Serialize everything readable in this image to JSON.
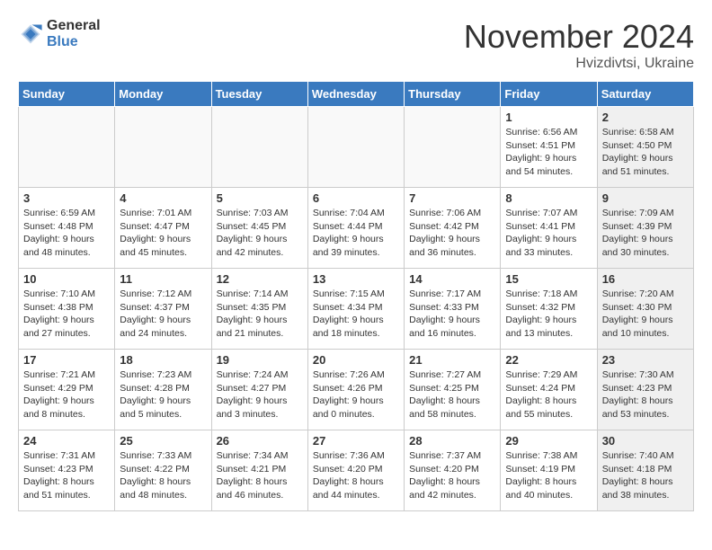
{
  "header": {
    "logo_general": "General",
    "logo_blue": "Blue",
    "month_title": "November 2024",
    "location": "Hvizdivtsi, Ukraine"
  },
  "weekdays": [
    "Sunday",
    "Monday",
    "Tuesday",
    "Wednesday",
    "Thursday",
    "Friday",
    "Saturday"
  ],
  "weeks": [
    [
      {
        "day": "",
        "info": "",
        "shaded": false,
        "empty": true
      },
      {
        "day": "",
        "info": "",
        "shaded": false,
        "empty": true
      },
      {
        "day": "",
        "info": "",
        "shaded": false,
        "empty": true
      },
      {
        "day": "",
        "info": "",
        "shaded": false,
        "empty": true
      },
      {
        "day": "",
        "info": "",
        "shaded": false,
        "empty": true
      },
      {
        "day": "1",
        "info": "Sunrise: 6:56 AM\nSunset: 4:51 PM\nDaylight: 9 hours\nand 54 minutes.",
        "shaded": false,
        "empty": false
      },
      {
        "day": "2",
        "info": "Sunrise: 6:58 AM\nSunset: 4:50 PM\nDaylight: 9 hours\nand 51 minutes.",
        "shaded": true,
        "empty": false
      }
    ],
    [
      {
        "day": "3",
        "info": "Sunrise: 6:59 AM\nSunset: 4:48 PM\nDaylight: 9 hours\nand 48 minutes.",
        "shaded": false,
        "empty": false
      },
      {
        "day": "4",
        "info": "Sunrise: 7:01 AM\nSunset: 4:47 PM\nDaylight: 9 hours\nand 45 minutes.",
        "shaded": false,
        "empty": false
      },
      {
        "day": "5",
        "info": "Sunrise: 7:03 AM\nSunset: 4:45 PM\nDaylight: 9 hours\nand 42 minutes.",
        "shaded": false,
        "empty": false
      },
      {
        "day": "6",
        "info": "Sunrise: 7:04 AM\nSunset: 4:44 PM\nDaylight: 9 hours\nand 39 minutes.",
        "shaded": false,
        "empty": false
      },
      {
        "day": "7",
        "info": "Sunrise: 7:06 AM\nSunset: 4:42 PM\nDaylight: 9 hours\nand 36 minutes.",
        "shaded": false,
        "empty": false
      },
      {
        "day": "8",
        "info": "Sunrise: 7:07 AM\nSunset: 4:41 PM\nDaylight: 9 hours\nand 33 minutes.",
        "shaded": false,
        "empty": false
      },
      {
        "day": "9",
        "info": "Sunrise: 7:09 AM\nSunset: 4:39 PM\nDaylight: 9 hours\nand 30 minutes.",
        "shaded": true,
        "empty": false
      }
    ],
    [
      {
        "day": "10",
        "info": "Sunrise: 7:10 AM\nSunset: 4:38 PM\nDaylight: 9 hours\nand 27 minutes.",
        "shaded": false,
        "empty": false
      },
      {
        "day": "11",
        "info": "Sunrise: 7:12 AM\nSunset: 4:37 PM\nDaylight: 9 hours\nand 24 minutes.",
        "shaded": false,
        "empty": false
      },
      {
        "day": "12",
        "info": "Sunrise: 7:14 AM\nSunset: 4:35 PM\nDaylight: 9 hours\nand 21 minutes.",
        "shaded": false,
        "empty": false
      },
      {
        "day": "13",
        "info": "Sunrise: 7:15 AM\nSunset: 4:34 PM\nDaylight: 9 hours\nand 18 minutes.",
        "shaded": false,
        "empty": false
      },
      {
        "day": "14",
        "info": "Sunrise: 7:17 AM\nSunset: 4:33 PM\nDaylight: 9 hours\nand 16 minutes.",
        "shaded": false,
        "empty": false
      },
      {
        "day": "15",
        "info": "Sunrise: 7:18 AM\nSunset: 4:32 PM\nDaylight: 9 hours\nand 13 minutes.",
        "shaded": false,
        "empty": false
      },
      {
        "day": "16",
        "info": "Sunrise: 7:20 AM\nSunset: 4:30 PM\nDaylight: 9 hours\nand 10 minutes.",
        "shaded": true,
        "empty": false
      }
    ],
    [
      {
        "day": "17",
        "info": "Sunrise: 7:21 AM\nSunset: 4:29 PM\nDaylight: 9 hours\nand 8 minutes.",
        "shaded": false,
        "empty": false
      },
      {
        "day": "18",
        "info": "Sunrise: 7:23 AM\nSunset: 4:28 PM\nDaylight: 9 hours\nand 5 minutes.",
        "shaded": false,
        "empty": false
      },
      {
        "day": "19",
        "info": "Sunrise: 7:24 AM\nSunset: 4:27 PM\nDaylight: 9 hours\nand 3 minutes.",
        "shaded": false,
        "empty": false
      },
      {
        "day": "20",
        "info": "Sunrise: 7:26 AM\nSunset: 4:26 PM\nDaylight: 9 hours\nand 0 minutes.",
        "shaded": false,
        "empty": false
      },
      {
        "day": "21",
        "info": "Sunrise: 7:27 AM\nSunset: 4:25 PM\nDaylight: 8 hours\nand 58 minutes.",
        "shaded": false,
        "empty": false
      },
      {
        "day": "22",
        "info": "Sunrise: 7:29 AM\nSunset: 4:24 PM\nDaylight: 8 hours\nand 55 minutes.",
        "shaded": false,
        "empty": false
      },
      {
        "day": "23",
        "info": "Sunrise: 7:30 AM\nSunset: 4:23 PM\nDaylight: 8 hours\nand 53 minutes.",
        "shaded": true,
        "empty": false
      }
    ],
    [
      {
        "day": "24",
        "info": "Sunrise: 7:31 AM\nSunset: 4:23 PM\nDaylight: 8 hours\nand 51 minutes.",
        "shaded": false,
        "empty": false
      },
      {
        "day": "25",
        "info": "Sunrise: 7:33 AM\nSunset: 4:22 PM\nDaylight: 8 hours\nand 48 minutes.",
        "shaded": false,
        "empty": false
      },
      {
        "day": "26",
        "info": "Sunrise: 7:34 AM\nSunset: 4:21 PM\nDaylight: 8 hours\nand 46 minutes.",
        "shaded": false,
        "empty": false
      },
      {
        "day": "27",
        "info": "Sunrise: 7:36 AM\nSunset: 4:20 PM\nDaylight: 8 hours\nand 44 minutes.",
        "shaded": false,
        "empty": false
      },
      {
        "day": "28",
        "info": "Sunrise: 7:37 AM\nSunset: 4:20 PM\nDaylight: 8 hours\nand 42 minutes.",
        "shaded": false,
        "empty": false
      },
      {
        "day": "29",
        "info": "Sunrise: 7:38 AM\nSunset: 4:19 PM\nDaylight: 8 hours\nand 40 minutes.",
        "shaded": false,
        "empty": false
      },
      {
        "day": "30",
        "info": "Sunrise: 7:40 AM\nSunset: 4:18 PM\nDaylight: 8 hours\nand 38 minutes.",
        "shaded": true,
        "empty": false
      }
    ]
  ]
}
